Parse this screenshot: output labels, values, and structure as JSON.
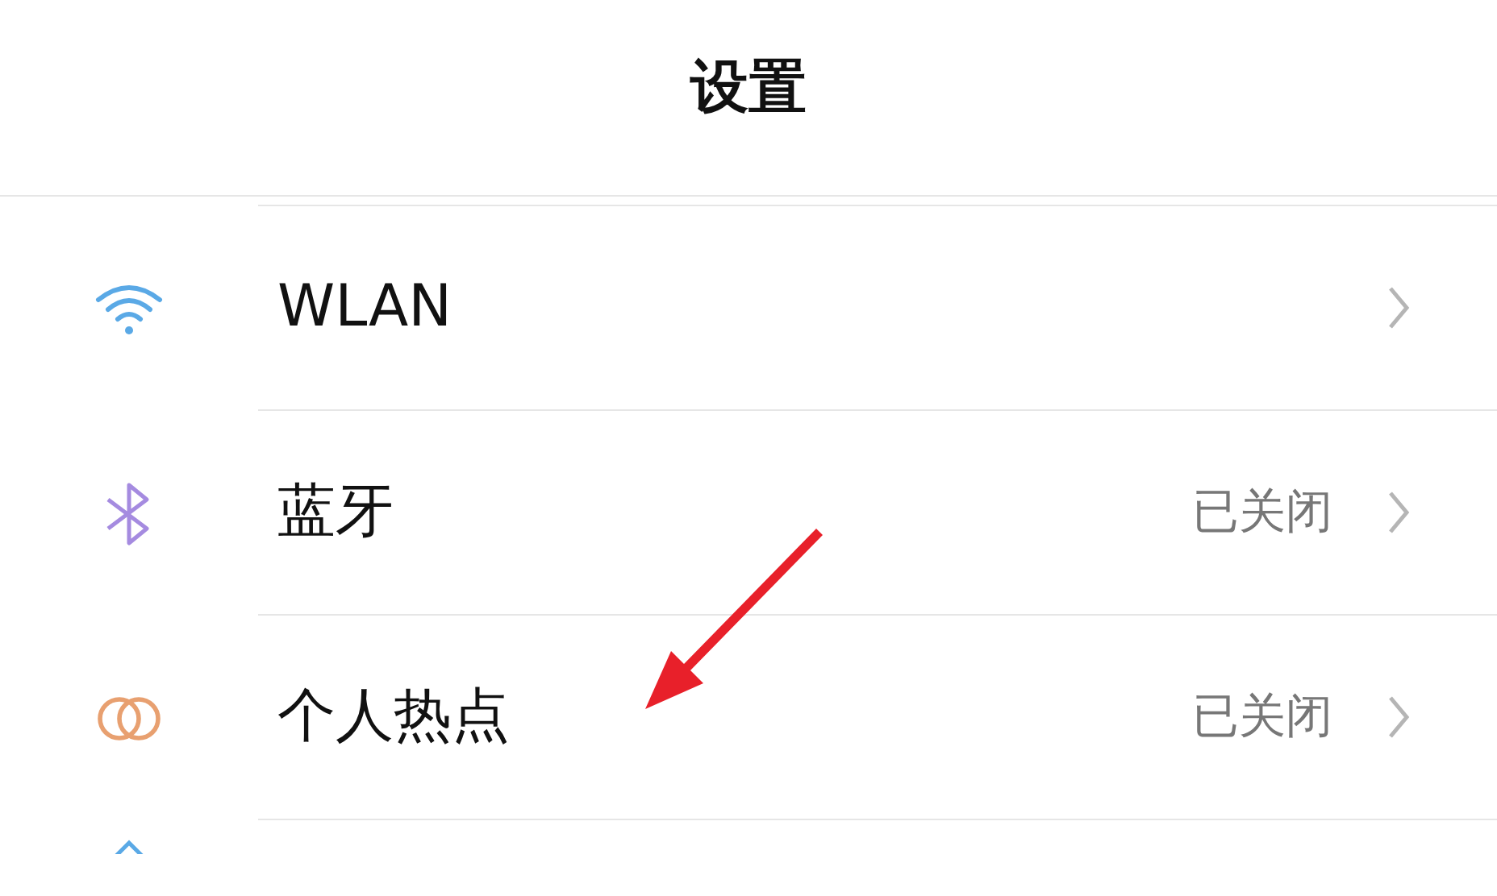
{
  "header": {
    "title": "设置"
  },
  "rows": [
    {
      "kind": "wifi",
      "label": "WLAN"
    },
    {
      "kind": "bluetooth",
      "label": "蓝牙",
      "value": "已关闭"
    },
    {
      "kind": "hotspot",
      "label": "个人热点",
      "value": "已关闭"
    },
    {
      "kind": "partial"
    }
  ]
}
